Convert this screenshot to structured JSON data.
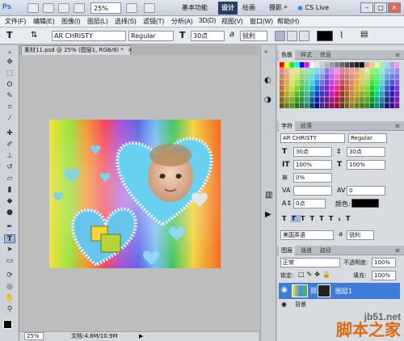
{
  "app": {
    "logo": "Ps",
    "zoom": "25%",
    "workspace_basic": "基本功能",
    "workspace_design": "设计",
    "workspace_draw": "绘画",
    "workspace_photo": "摄影",
    "workspace_more": "»",
    "cs_live": "CS Live"
  },
  "menu": [
    "文件(F)",
    "编辑(E)",
    "图像(I)",
    "图层(L)",
    "选择(S)",
    "滤镜(T)",
    "分析(A)",
    "3D(D)",
    "视图(V)",
    "窗口(W)",
    "帮助(H)"
  ],
  "options": {
    "font_family": "AR CHRISTY",
    "font_style": "Regular",
    "font_size": "30点",
    "aa_prefix": "a",
    "anti_alias": "锐利",
    "text_color": "#000000"
  },
  "document": {
    "tab1": "素材11.psd @ 25% (图层1, RGB/8) *",
    "tab2": "",
    "status_zoom": "25%",
    "status_doc": "文档:4.8M/10.9M"
  },
  "swatch_panel": {
    "tabs": [
      "色板",
      "样式",
      "信息"
    ]
  },
  "char_panel": {
    "tabs": [
      "字符",
      "段落"
    ],
    "font_family": "AR CHRISTY",
    "font_style": "Regular",
    "size": "30点",
    "leading": "30点",
    "vscale": "100%",
    "hscale": "100%",
    "tracking_a": "0%",
    "tracking_b": "0",
    "baseline": "0点",
    "color_label": "颜色:",
    "language": "美国英语",
    "aa_prefix": "a",
    "aa": "锐利"
  },
  "layers_panel": {
    "tabs": [
      "图层",
      "通道",
      "路径"
    ],
    "blend": "正常",
    "opacity_label": "不透明度:",
    "opacity": "100%",
    "lock_label": "锁定:",
    "fill_label": "填充:",
    "fill": "100%",
    "layer1": "图层1",
    "layer2": "背景"
  },
  "watermark": {
    "site": "jb51.net",
    "cn": "脚本之家"
  },
  "colors": {
    "accent_dark": "#2a3d63",
    "layer_highlight": "#3d7dd8"
  }
}
